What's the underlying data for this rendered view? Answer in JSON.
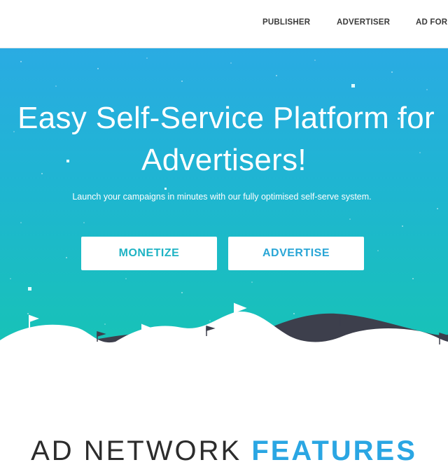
{
  "nav": {
    "items": [
      "PUBLISHER",
      "ADVERTISER",
      "AD FOR"
    ]
  },
  "hero": {
    "title_line1": "Easy Self-Service Platform for",
    "title_line2": "Advertisers!",
    "subtitle": "Launch your campaigns in minutes with our fully optimised self-serve system.",
    "buttons": {
      "monetize": "MONETIZE",
      "advertise": "ADVERTISE"
    }
  },
  "features": {
    "title_part1": "AD NETWORK",
    "title_part2": "FEATURES"
  },
  "colors": {
    "gradient_top": "#2aabe3",
    "gradient_bottom": "#17c3b6",
    "button_text": "#1fb3c4",
    "mountain_dark": "#3d3f4c",
    "accent": "#2aa6e3"
  }
}
